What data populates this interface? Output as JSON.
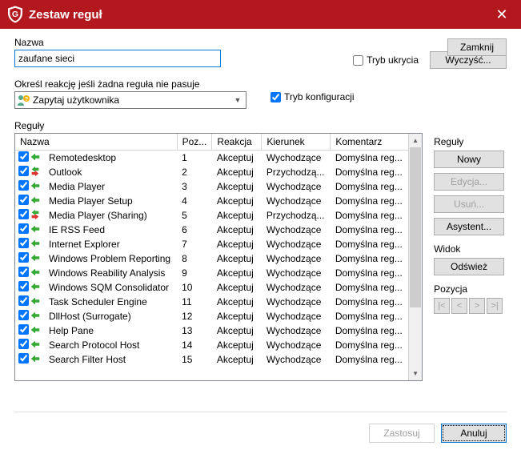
{
  "window": {
    "title": "Zestaw reguł"
  },
  "buttons": {
    "zamknij": "Zamknij",
    "wyczysc": "Wyczyść...",
    "nowy": "Nowy",
    "edycja": "Edycja...",
    "usun": "Usuń...",
    "asystent": "Asystent...",
    "odswiez": "Odśwież",
    "zastosuj": "Zastosuj",
    "anuluj": "Anuluj"
  },
  "labels": {
    "nazwa": "Nazwa",
    "tryb_ukrycia": "Tryb ukrycia",
    "reakcja_header": "Określ reakcję jeśli żadna reguła nie pasuje",
    "tryb_konfig": "Tryb konfiguracji",
    "reguly": "Reguły",
    "widok": "Widok",
    "pozycja": "Pozycja"
  },
  "name_value": "zaufane sieci",
  "reaction_selected": "Zapytaj użytkownika",
  "tryb_ukrycia_checked": false,
  "tryb_konfig_checked": true,
  "columns": {
    "nazwa": "Nazwa",
    "poz": "Poz...",
    "reakcja": "Reakcja",
    "kierunek": "Kierunek",
    "komentarz": "Komentarz"
  },
  "rows": [
    {
      "checked": true,
      "dir": "out",
      "name": "Remotedesktop",
      "poz": "1",
      "reakcja": "Akceptuj",
      "kierunek": "Wychodzące",
      "komentarz": "Domyślna reg..."
    },
    {
      "checked": true,
      "dir": "both",
      "name": "Outlook",
      "poz": "2",
      "reakcja": "Akceptuj",
      "kierunek": "Przychodzą...",
      "komentarz": "Domyślna reg..."
    },
    {
      "checked": true,
      "dir": "out",
      "name": "Media Player",
      "poz": "3",
      "reakcja": "Akceptuj",
      "kierunek": "Wychodzące",
      "komentarz": "Domyślna reg..."
    },
    {
      "checked": true,
      "dir": "out",
      "name": "Media Player Setup",
      "poz": "4",
      "reakcja": "Akceptuj",
      "kierunek": "Wychodzące",
      "komentarz": "Domyślna reg..."
    },
    {
      "checked": true,
      "dir": "both",
      "name": "Media Player (Sharing)",
      "poz": "5",
      "reakcja": "Akceptuj",
      "kierunek": "Przychodzą...",
      "komentarz": "Domyślna reg..."
    },
    {
      "checked": true,
      "dir": "out",
      "name": "IE RSS Feed",
      "poz": "6",
      "reakcja": "Akceptuj",
      "kierunek": "Wychodzące",
      "komentarz": "Domyślna reg..."
    },
    {
      "checked": true,
      "dir": "out",
      "name": "Internet Explorer",
      "poz": "7",
      "reakcja": "Akceptuj",
      "kierunek": "Wychodzące",
      "komentarz": "Domyślna reg..."
    },
    {
      "checked": true,
      "dir": "out",
      "name": "Windows Problem Reporting",
      "poz": "8",
      "reakcja": "Akceptuj",
      "kierunek": "Wychodzące",
      "komentarz": "Domyślna reg..."
    },
    {
      "checked": true,
      "dir": "out",
      "name": "Windows Reability Analysis",
      "poz": "9",
      "reakcja": "Akceptuj",
      "kierunek": "Wychodzące",
      "komentarz": "Domyślna reg..."
    },
    {
      "checked": true,
      "dir": "out",
      "name": "Windows SQM Consolidator",
      "poz": "10",
      "reakcja": "Akceptuj",
      "kierunek": "Wychodzące",
      "komentarz": "Domyślna reg..."
    },
    {
      "checked": true,
      "dir": "out",
      "name": "Task Scheduler Engine",
      "poz": "11",
      "reakcja": "Akceptuj",
      "kierunek": "Wychodzące",
      "komentarz": "Domyślna reg..."
    },
    {
      "checked": true,
      "dir": "out",
      "name": "DllHost (Surrogate)",
      "poz": "12",
      "reakcja": "Akceptuj",
      "kierunek": "Wychodzące",
      "komentarz": "Domyślna reg..."
    },
    {
      "checked": true,
      "dir": "out",
      "name": "Help Pane",
      "poz": "13",
      "reakcja": "Akceptuj",
      "kierunek": "Wychodzące",
      "komentarz": "Domyślna reg..."
    },
    {
      "checked": true,
      "dir": "out",
      "name": "Search Protocol Host",
      "poz": "14",
      "reakcja": "Akceptuj",
      "kierunek": "Wychodzące",
      "komentarz": "Domyślna reg..."
    },
    {
      "checked": true,
      "dir": "out",
      "name": "Search Filter Host",
      "poz": "15",
      "reakcja": "Akceptuj",
      "kierunek": "Wychodzące",
      "komentarz": "Domyślna reg..."
    }
  ],
  "pos_buttons": [
    "|<",
    "<",
    ">",
    ">|"
  ]
}
